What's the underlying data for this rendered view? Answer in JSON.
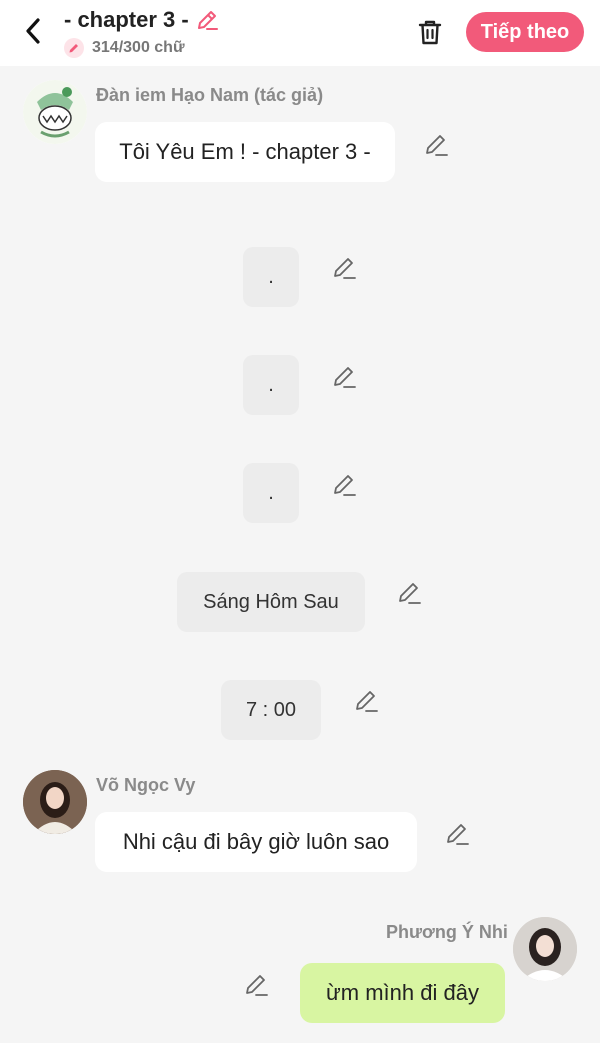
{
  "header": {
    "title": "- chapter 3 -",
    "word_count": "314/300 chữ",
    "next_button": "Tiếp theo"
  },
  "messages": [
    {
      "type": "character",
      "author": "Đàn iem Hạo Nam (tác giả)",
      "text": "Tôi Yêu Em ! - chapter 3 -"
    },
    {
      "type": "narration",
      "text": "."
    },
    {
      "type": "narration",
      "text": "."
    },
    {
      "type": "narration",
      "text": "."
    },
    {
      "type": "narration",
      "text": "Sáng Hôm Sau"
    },
    {
      "type": "narration",
      "text": "7 : 00"
    },
    {
      "type": "character",
      "author": "Võ Ngọc Vy",
      "text": "Nhi cậu đi bây giờ luôn sao"
    },
    {
      "type": "self",
      "author": "Phương Ý Nhi",
      "text": "ừm mình đi đây"
    }
  ],
  "colors": {
    "accent": "#f25a7a",
    "self_bubble": "#d8f5a2",
    "background": "#f5f5f5"
  },
  "icons": [
    "back-arrow-icon",
    "pencil-icon",
    "trash-icon"
  ]
}
